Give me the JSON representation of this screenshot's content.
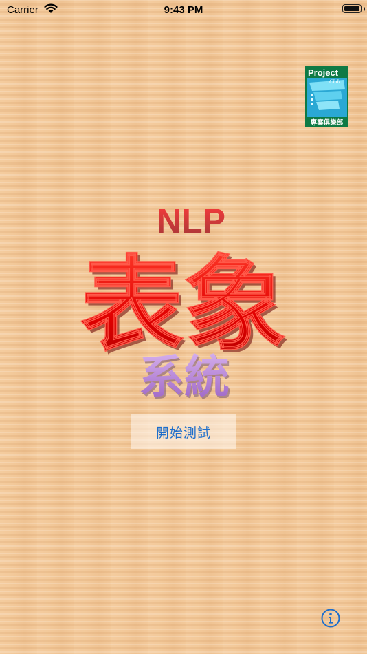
{
  "status_bar": {
    "carrier": "Carrier",
    "time": "9:43 PM",
    "wifi_icon": "wifi-icon",
    "battery_icon": "battery-full-icon"
  },
  "logo": {
    "top_text": "Project",
    "sub_text": "Club",
    "bottom_text": "專案俱樂部"
  },
  "title": {
    "prefix": "NLP",
    "main": "表象",
    "sub": "系統"
  },
  "start_button": {
    "label": "開始測試"
  },
  "info_button": {
    "icon": "info-icon"
  },
  "colors": {
    "accent_blue": "#1e6ecb",
    "title_red": "#e00000",
    "title_purple": "#b98ad6",
    "logo_green": "#0e7a45",
    "logo_cyan": "#35c4e8"
  }
}
